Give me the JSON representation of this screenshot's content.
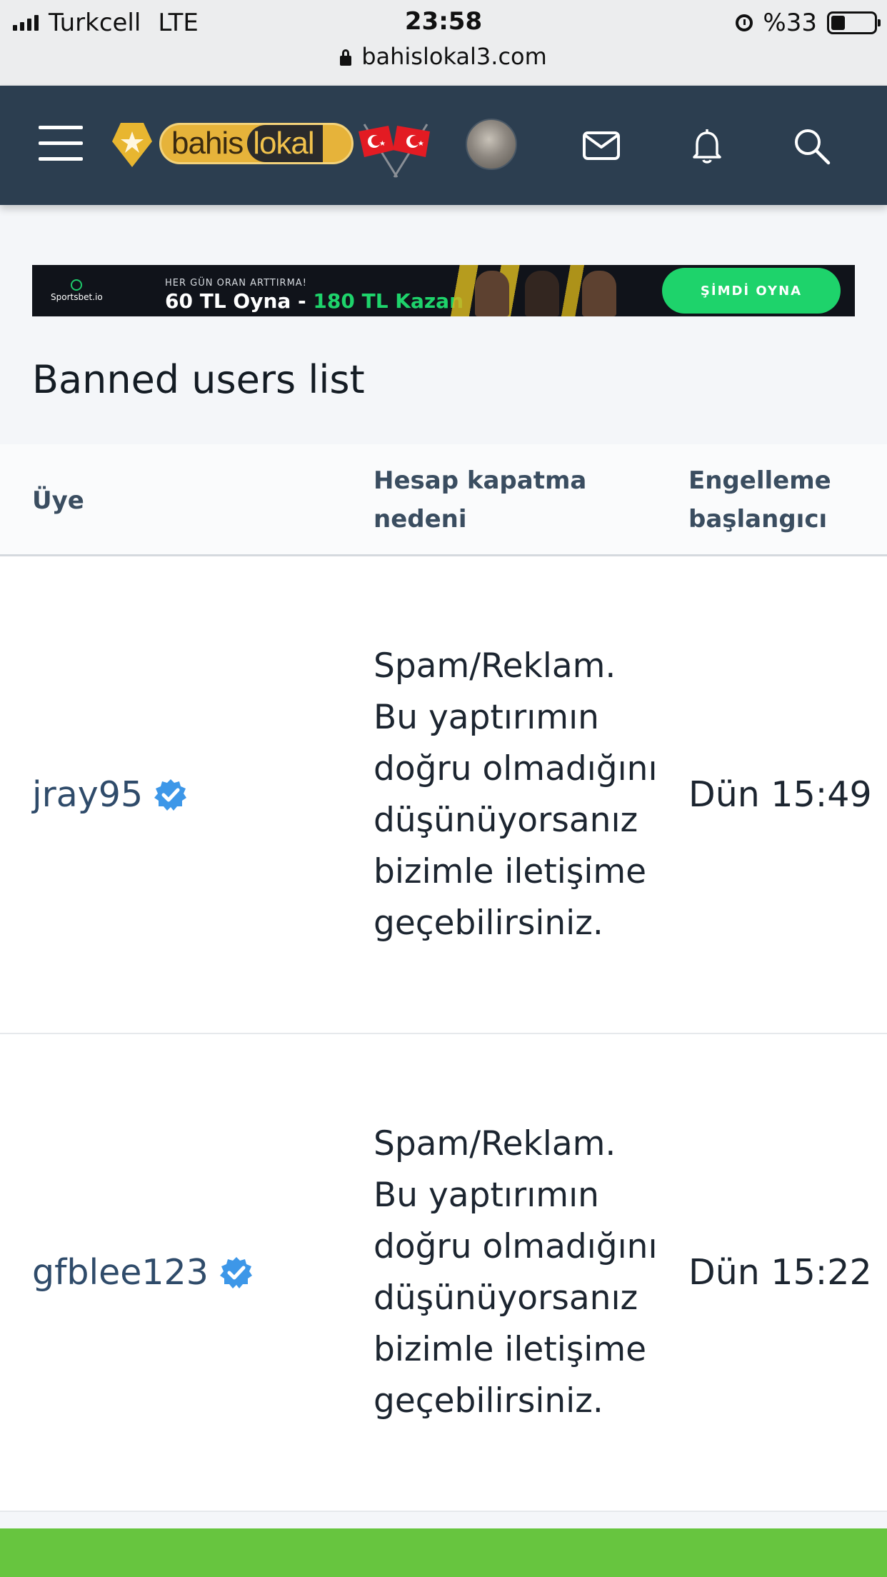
{
  "status_bar": {
    "carrier": "Turkcell",
    "network": "LTE",
    "time": "23:58",
    "battery": "%33",
    "battery_level": 0.33,
    "url": "bahislokal3.com"
  },
  "header": {
    "logo_part1": "bahis",
    "logo_part2": "lokal",
    "icons": [
      "menu-icon",
      "mail-icon",
      "bell-icon",
      "search-icon"
    ]
  },
  "banner": {
    "brand": "Sportsbet.io",
    "tagline": "HER GÜN ORAN ARTTIRMA!",
    "promo_white": "60 TL Oyna - ",
    "promo_green": "180 TL Kazan",
    "cta": "ŞİMDİ OYNA"
  },
  "page": {
    "title": "Banned users list"
  },
  "table": {
    "columns": [
      "Üye",
      "Hesap kapatma nedeni",
      "Engelleme başlangıcı"
    ],
    "rows": [
      {
        "user": "jray95",
        "reason": "Spam/Reklam. Bu yaptırımın doğru olmadığını düşünüyorsanız bizimle iletişime geçebilirsiniz.",
        "date": "Dün 15:49"
      },
      {
        "user": "gfblee123",
        "reason": "Spam/Reklam. Bu yaptırımın doğru olmadığını düşünüyorsanız bizimle iletişime geçebilirsiniz.",
        "date": "Dün 15:22"
      }
    ]
  },
  "colors": {
    "header_bg": "#2c3e50",
    "accent_green": "#67c53f",
    "verified_blue": "#3d97e8",
    "username": "#2f4b6a"
  }
}
